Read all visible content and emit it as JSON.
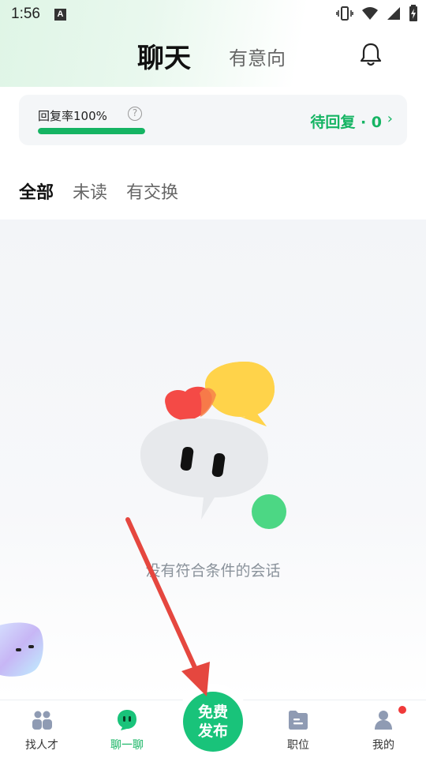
{
  "status_bar": {
    "time": "1:56",
    "notification_icon": "A"
  },
  "header": {
    "tabs": [
      {
        "label": "聊天",
        "active": true
      },
      {
        "label": "有意向",
        "active": false
      }
    ],
    "bell_icon": "bell-icon"
  },
  "reply_card": {
    "rate_label": "回复率100%",
    "rate_value": 1.0,
    "help_icon": "?",
    "pending_label": "待回复 · 0",
    "pending_chevron": "›"
  },
  "filters": [
    {
      "label": "全部",
      "active": true
    },
    {
      "label": "未读",
      "active": false
    },
    {
      "label": "有交换",
      "active": false
    }
  ],
  "empty_state": {
    "text": "没有符合条件的会话"
  },
  "bottom_nav": {
    "items": [
      {
        "label": "找人才",
        "icon": "people-icon",
        "active": false
      },
      {
        "label": "聊一聊",
        "icon": "chat-bubble-icon",
        "active": true
      },
      {
        "label": "职位",
        "icon": "folder-icon",
        "active": false
      },
      {
        "label": "我的",
        "icon": "user-icon",
        "active": false
      }
    ],
    "publish": {
      "line1": "免费",
      "line2": "发布"
    }
  },
  "colors": {
    "accent": "#15b463",
    "publish": "#19c37a",
    "badge": "#f03a3a",
    "annotation_arrow": "#e5473f"
  }
}
